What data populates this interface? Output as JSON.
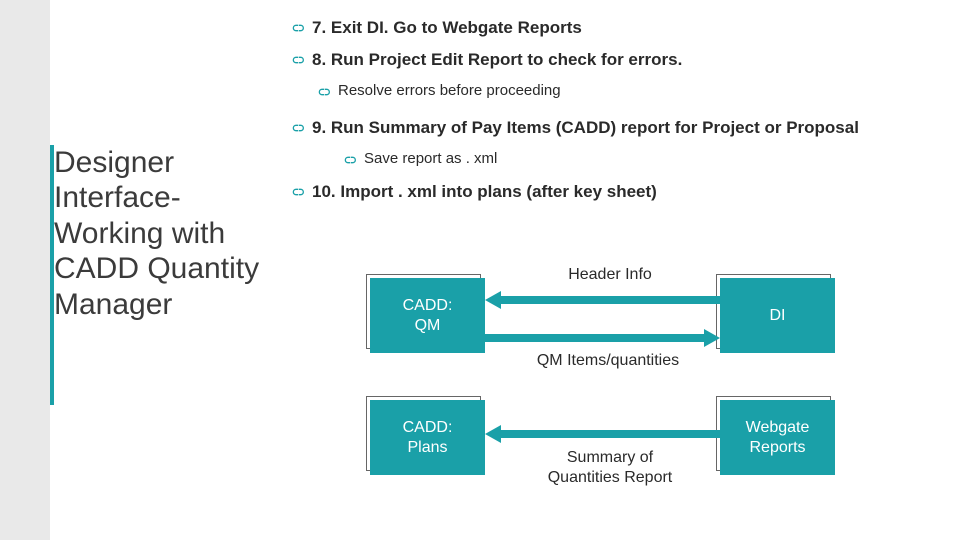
{
  "title": "Designer Interface- Working with CADD Quantity Manager",
  "bullets": {
    "b7": "7. Exit DI. Go to Webgate Reports",
    "b8": "8. Run Project Edit Report to check for errors.",
    "b8a": "Resolve errors before proceeding",
    "b9": "9. Run Summary of Pay Items (CADD) report for Project or Proposal",
    "b9a": "Save report as . xml",
    "b10": "10. Import . xml into plans (after key sheet)"
  },
  "diagram": {
    "box1": "CADD:\nQM",
    "box2": "DI",
    "box3": "CADD:\nPlans",
    "box4": "Webgate\nReports",
    "arrow1": "Header Info",
    "arrow2": "QM Items/quantities",
    "arrow3": "Summary of\nQuantities Report"
  }
}
